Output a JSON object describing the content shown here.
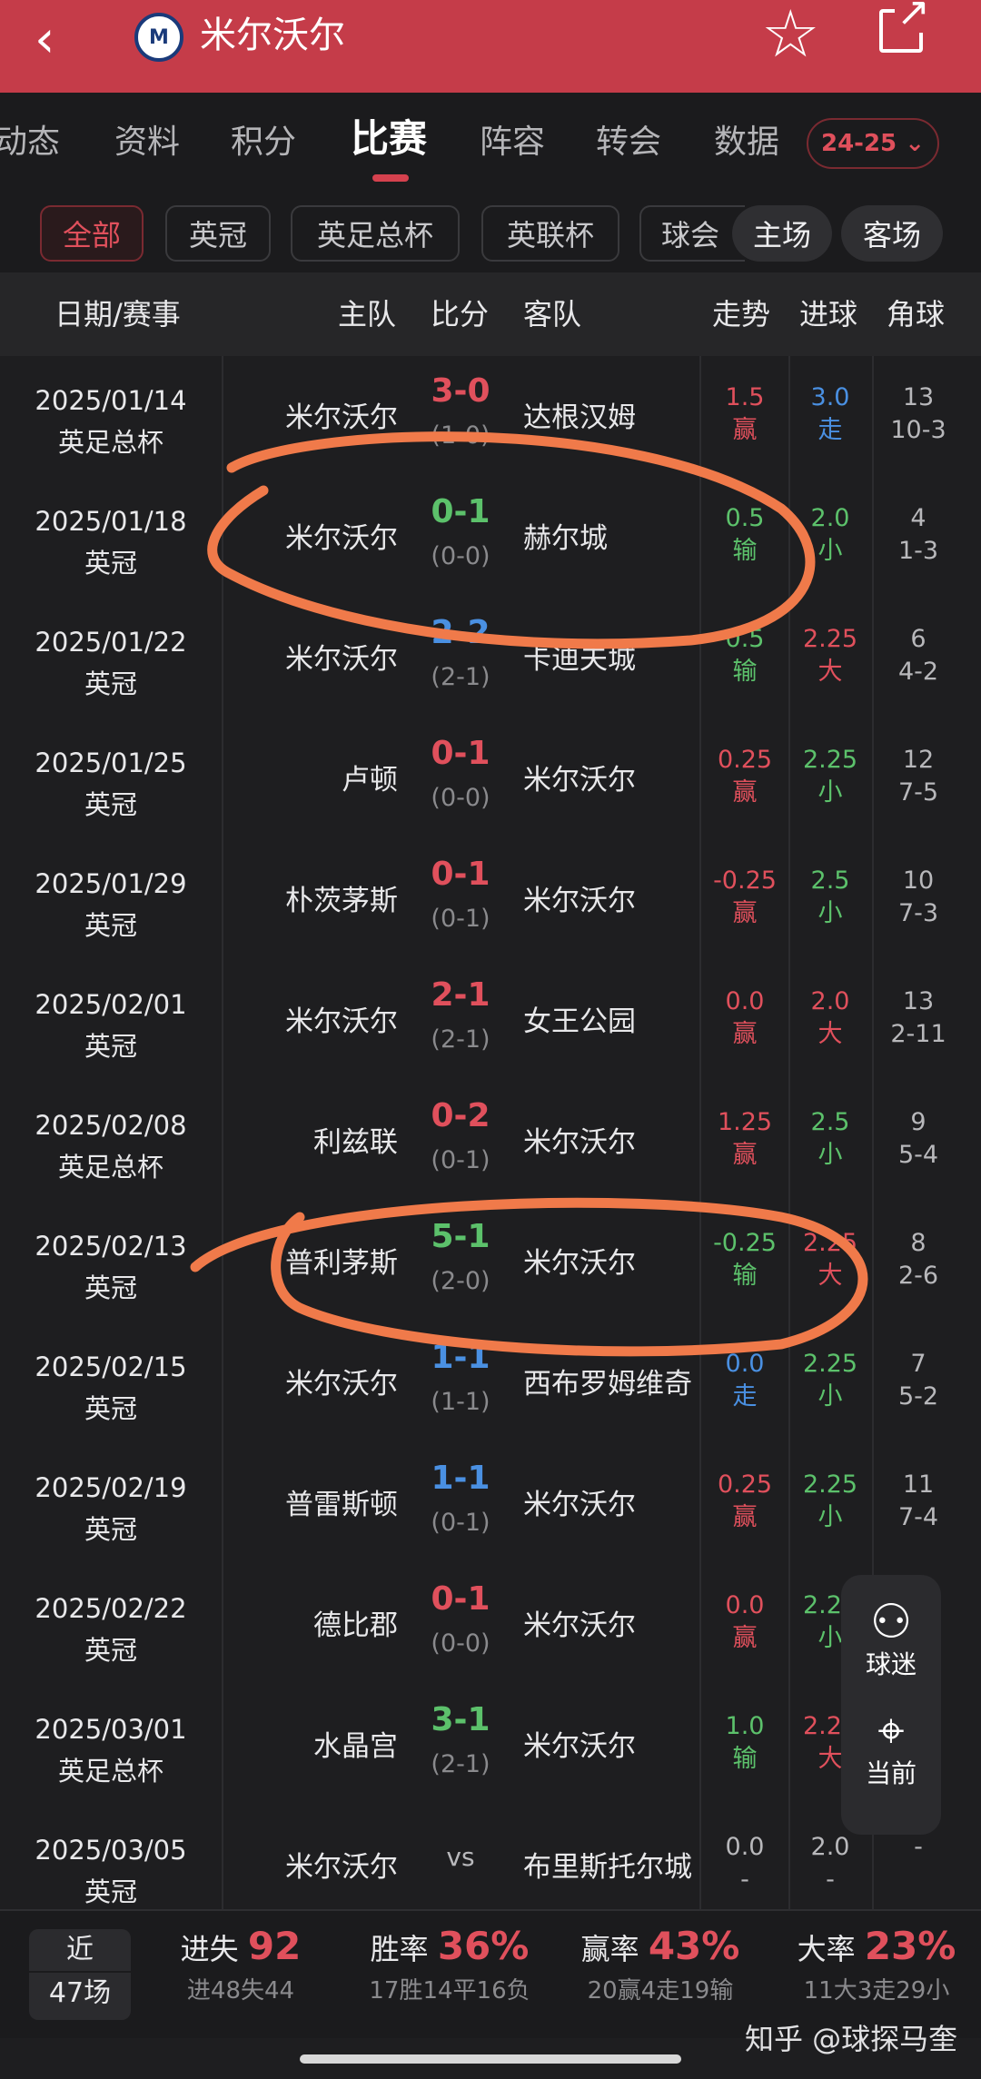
{
  "top": {
    "back_icon": "chevron-left-icon",
    "title": "米尔沃尔",
    "star_icon": "star-outline-icon",
    "share_icon": "share-icon"
  },
  "tabs": [
    "动态",
    "资料",
    "积分",
    "比赛",
    "阵容",
    "转会",
    "数据"
  ],
  "active_tab": "比赛",
  "season": "24-25",
  "filters": [
    "全部",
    "英冠",
    "英足总杯",
    "英联杯",
    "球会"
  ],
  "venue_filters": [
    "主场",
    "客场"
  ],
  "columns": {
    "date": "日期/赛事",
    "home": "主队",
    "score": "比分",
    "away": "客队",
    "trend": "走势",
    "goals": "进球",
    "corners": "角球"
  },
  "matches": [
    {
      "date": "2025/01/14",
      "comp": "英足总杯",
      "home": "米尔沃尔",
      "score": "3-0",
      "half": "(1-0)",
      "away": "达根汉姆",
      "trend_line": "1.5",
      "trend_res": "赢",
      "goal_line": "3.0",
      "goal_res": "走",
      "corner_total": "13",
      "corner_split": "10-3"
    },
    {
      "date": "2025/01/18",
      "comp": "英冠",
      "home": "米尔沃尔",
      "score": "0-1",
      "half": "(0-0)",
      "away": "赫尔城",
      "trend_line": "0.5",
      "trend_res": "输",
      "goal_line": "2.0",
      "goal_res": "小",
      "corner_total": "4",
      "corner_split": "1-3"
    },
    {
      "date": "2025/01/22",
      "comp": "英冠",
      "home": "米尔沃尔",
      "score": "2-2",
      "half": "(2-1)",
      "away": "卡迪夫城",
      "trend_line": "0.5",
      "trend_res": "输",
      "goal_line": "2.25",
      "goal_res": "大",
      "corner_total": "6",
      "corner_split": "4-2"
    },
    {
      "date": "2025/01/25",
      "comp": "英冠",
      "home": "卢顿",
      "score": "0-1",
      "half": "(0-0)",
      "away": "米尔沃尔",
      "trend_line": "0.25",
      "trend_res": "赢",
      "goal_line": "2.25",
      "goal_res": "小",
      "corner_total": "12",
      "corner_split": "7-5"
    },
    {
      "date": "2025/01/29",
      "comp": "英冠",
      "home": "朴茨茅斯",
      "score": "0-1",
      "half": "(0-1)",
      "away": "米尔沃尔",
      "trend_line": "-0.25",
      "trend_res": "赢",
      "goal_line": "2.5",
      "goal_res": "小",
      "corner_total": "10",
      "corner_split": "7-3"
    },
    {
      "date": "2025/02/01",
      "comp": "英冠",
      "home": "米尔沃尔",
      "score": "2-1",
      "half": "(2-1)",
      "away": "女王公园",
      "trend_line": "0.0",
      "trend_res": "赢",
      "goal_line": "2.0",
      "goal_res": "大",
      "corner_total": "13",
      "corner_split": "2-11"
    },
    {
      "date": "2025/02/08",
      "comp": "英足总杯",
      "home": "利兹联",
      "score": "0-2",
      "half": "(0-1)",
      "away": "米尔沃尔",
      "trend_line": "1.25",
      "trend_res": "赢",
      "goal_line": "2.5",
      "goal_res": "小",
      "corner_total": "9",
      "corner_split": "5-4"
    },
    {
      "date": "2025/02/13",
      "comp": "英冠",
      "home": "普利茅斯",
      "score": "5-1",
      "half": "(2-0)",
      "away": "米尔沃尔",
      "trend_line": "-0.25",
      "trend_res": "输",
      "goal_line": "2.25",
      "goal_res": "大",
      "corner_total": "8",
      "corner_split": "2-6"
    },
    {
      "date": "2025/02/15",
      "comp": "英冠",
      "home": "米尔沃尔",
      "score": "1-1",
      "half": "(1-1)",
      "away": "西布罗姆维奇",
      "trend_line": "0.0",
      "trend_res": "走",
      "goal_line": "2.25",
      "goal_res": "小",
      "corner_total": "7",
      "corner_split": "5-2"
    },
    {
      "date": "2025/02/19",
      "comp": "英冠",
      "home": "普雷斯顿",
      "score": "1-1",
      "half": "(0-1)",
      "away": "米尔沃尔",
      "trend_line": "0.25",
      "trend_res": "赢",
      "goal_line": "2.25",
      "goal_res": "小",
      "corner_total": "11",
      "corner_split": "7-4"
    },
    {
      "date": "2025/02/22",
      "comp": "英冠",
      "home": "德比郡",
      "score": "0-1",
      "half": "(0-0)",
      "away": "米尔沃尔",
      "trend_line": "0.0",
      "trend_res": "赢",
      "goal_line": "2.25",
      "goal_res": "小",
      "corner_total": "",
      "corner_split": ""
    },
    {
      "date": "2025/03/01",
      "comp": "英足总杯",
      "home": "水晶宫",
      "score": "3-1",
      "half": "(2-1)",
      "away": "米尔沃尔",
      "trend_line": "1.0",
      "trend_res": "输",
      "goal_line": "2.25",
      "goal_res": "大",
      "corner_total": "",
      "corner_split": ""
    },
    {
      "date": "2025/03/05",
      "comp": "英冠",
      "home": "米尔沃尔",
      "score": "vs",
      "half": "",
      "away": "布里斯托尔城",
      "trend_line": "0.0",
      "trend_res": "-",
      "goal_line": "2.0",
      "goal_res": "-",
      "corner_total": "-",
      "corner_split": ""
    }
  ],
  "score_colors": [
    "red",
    "green",
    "blue",
    "red",
    "red",
    "red",
    "red",
    "green",
    "blue",
    "blue",
    "red",
    "green",
    "grey"
  ],
  "trend_colors": [
    "red",
    "green",
    "green",
    "red",
    "red",
    "red",
    "red",
    "green",
    "blue",
    "red",
    "red",
    "green",
    "grey"
  ],
  "goal_colors": [
    "blue",
    "green",
    "red",
    "green",
    "green",
    "red",
    "green",
    "red",
    "green",
    "green",
    "green",
    "red",
    "grey"
  ],
  "float": {
    "fans_icon": "fans-icon",
    "fans_label": "球迷",
    "locate_icon": "crosshair-icon",
    "locate_label": "当前"
  },
  "summary": {
    "near_top": "近",
    "near_bottom": "47场",
    "goals_label": "进失",
    "goals_value": "92",
    "goals_sub": "进48失44",
    "win_label": "胜率",
    "win_value": "36%",
    "win_sub": "17胜14平16负",
    "cover_label": "赢率",
    "cover_value": "43%",
    "cover_sub": "20赢4走19输",
    "over_label": "大率",
    "over_value": "23%",
    "over_sub": "11大3走29小"
  },
  "watermark": "知乎 @球探马奎",
  "colors": {
    "brand": "#c53c49",
    "win": "#e0505c",
    "lose": "#5cc16b",
    "draw": "#4a90e2",
    "annotation": "#f07a4a"
  }
}
